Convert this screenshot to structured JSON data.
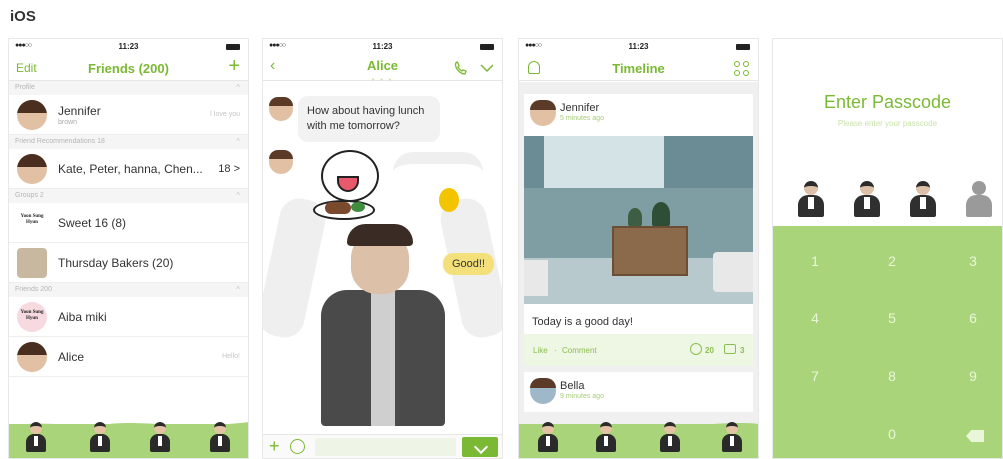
{
  "platform_label": "iOS",
  "status": {
    "time": "11:23",
    "signal": "●●●○○"
  },
  "friends": {
    "edit_label": "Edit",
    "title": "Friends (200)",
    "add_label": "+",
    "sections": {
      "profile": "Profile",
      "recommendations": "Friend Recommendations 18",
      "groups": "Groups 2",
      "friends": "Friends 200"
    },
    "profile": {
      "name": "Jennifer",
      "sub": "brown",
      "right": "I love you"
    },
    "recommendation": {
      "names": "Kate, Peter, hanna, Chen...",
      "count": "18 >"
    },
    "groups": [
      {
        "name": "Sweet 16 (8)",
        "logo": "Yoon Sung Hyun"
      },
      {
        "name": "Thursday Bakers (20)"
      }
    ],
    "list": [
      {
        "name": "Aiba miki",
        "logo": "Yoon Sung Hyun"
      },
      {
        "name": "Alice",
        "right": "Hello!"
      }
    ]
  },
  "chat": {
    "title": "Alice",
    "pager": "● ● ●",
    "message_text": "How about having lunch with me tomorrow?",
    "reply_text": "Good!!"
  },
  "timeline": {
    "title": "Timeline",
    "post": {
      "author": "Jennifer",
      "time": "5 minutes ago",
      "caption": "Today is a good day!",
      "like_label": "Like",
      "separator": "·",
      "comment_label": "Comment",
      "smile_count": "20",
      "comment_count": "3"
    },
    "next_post": {
      "author": "Bella",
      "time": "9 minutes ago"
    }
  },
  "passcode": {
    "title": "Enter Passcode",
    "subtitle": "Please enter your passcode",
    "keys": [
      "1",
      "2",
      "3",
      "4",
      "5",
      "6",
      "7",
      "8",
      "9",
      "0"
    ]
  },
  "colors": {
    "accent": "#7bb934",
    "keypad": "#a9d47a",
    "tabbar": "#a9d47a"
  },
  "icons": {
    "back": "chevron-left-icon",
    "call": "phone-icon",
    "more": "chevron-down-icon",
    "notifications": "bell-icon",
    "menu": "grid-icon",
    "delete": "backspace-icon"
  }
}
